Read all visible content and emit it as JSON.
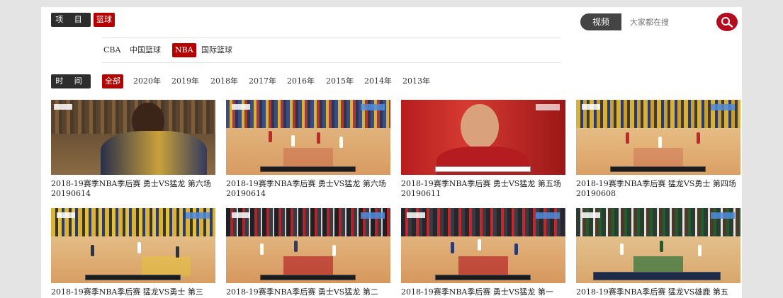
{
  "category": {
    "label": "项 目",
    "active": "篮球"
  },
  "search": {
    "label": "视频",
    "placeholder": "大家都在搜",
    "icon": "search-icon"
  },
  "subnav": {
    "items": [
      "CBA",
      "中国篮球",
      "NBA",
      "国际篮球"
    ],
    "active": "NBA"
  },
  "time": {
    "label": "时 间",
    "years": [
      "全部",
      "2020年",
      "2019年",
      "2018年",
      "2017年",
      "2016年",
      "2015年",
      "2014年",
      "2013年"
    ],
    "active": "全部"
  },
  "colors": {
    "accent": "#b50000",
    "search_button": "#b30c1f",
    "label_bg": "#2d2d2d"
  },
  "videos": [
    {
      "title": "2018-19赛季NBA季后赛 勇士VS猛龙 第六场 20190614",
      "scene": "closeup-player"
    },
    {
      "title": "2018-19赛季NBA季后赛 勇士VS猛龙 第六场 20190614",
      "scene": "court-red"
    },
    {
      "title": "2018-19赛季NBA季后赛 勇士VS猛龙 第五场 20190611",
      "scene": "closeup-fan"
    },
    {
      "title": "2018-19赛季NBA季后赛 猛龙VS勇士 第四场 20190608",
      "scene": "court-red"
    },
    {
      "title": "2018-19赛季NBA季后赛 猛龙VS勇士 第三",
      "scene": "court-gold"
    },
    {
      "title": "2018-19赛季NBA季后赛 勇士VS猛龙 第二",
      "scene": "court-red-dark"
    },
    {
      "title": "2018-19赛季NBA季后赛 勇士VS猛龙 第一",
      "scene": "court-red-dark"
    },
    {
      "title": "2018-19赛季NBA季后赛 猛龙VS雄鹿 第五",
      "scene": "court-green"
    }
  ]
}
